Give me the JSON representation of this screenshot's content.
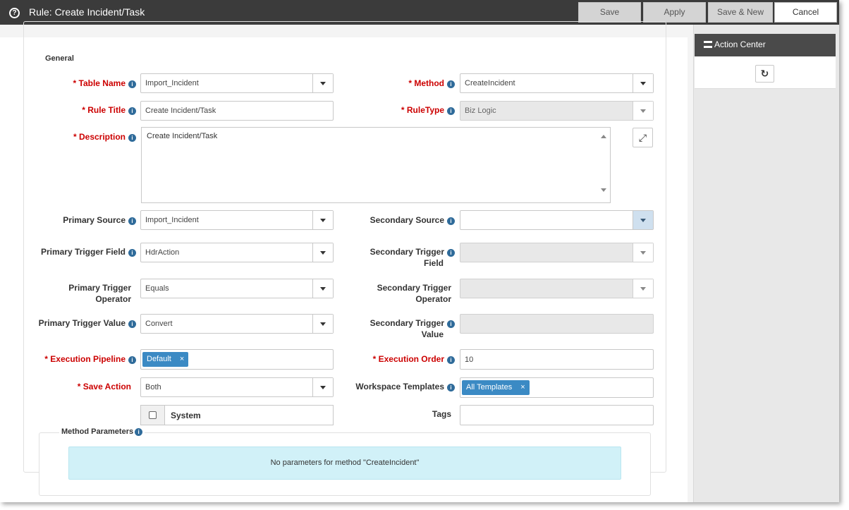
{
  "titlebar": {
    "title": "Rule: Create Incident/Task",
    "help_glyph": "?",
    "buttons": {
      "save": "Save",
      "apply": "Apply",
      "save_new": "Save & New",
      "cancel": "Cancel"
    }
  },
  "form": {
    "legend": "General",
    "table_name": {
      "label": "* Table Name",
      "value": "Import_Incident"
    },
    "method": {
      "label": "* Method",
      "value": "CreateIncident"
    },
    "rule_title": {
      "label": "* Rule Title",
      "value": "Create Incident/Task"
    },
    "rule_type": {
      "label": "* RuleType",
      "value": "Biz Logic"
    },
    "description": {
      "label": "* Description",
      "value": "Create Incident/Task"
    },
    "primary_source": {
      "label": "Primary Source",
      "value": "Import_Incident"
    },
    "secondary_source": {
      "label": "Secondary Source",
      "value": ""
    },
    "primary_trigger_field": {
      "label": "Primary Trigger Field",
      "value": "HdrAction"
    },
    "secondary_trigger_field": {
      "label_line1": "Secondary Trigger",
      "label_line2": "Field",
      "value": ""
    },
    "primary_trigger_operator": {
      "label_line1": "Primary Trigger",
      "label_line2": "Operator",
      "value": "Equals"
    },
    "secondary_trigger_operator": {
      "label_line1": "Secondary Trigger",
      "label_line2": "Operator",
      "value": ""
    },
    "primary_trigger_value": {
      "label": "Primary Trigger Value",
      "value": "Convert"
    },
    "secondary_trigger_value": {
      "label_line1": "Secondary Trigger",
      "label_line2": "Value",
      "value": ""
    },
    "execution_pipeline": {
      "label": "* Execution Pipeline",
      "tag": "Default"
    },
    "execution_order": {
      "label": "* Execution Order",
      "value": "10"
    },
    "save_action": {
      "label": "* Save Action",
      "value": "Both"
    },
    "workspace_templates": {
      "label": "Workspace Templates",
      "tag": "All Templates"
    },
    "system": {
      "label": "System",
      "checked": false
    },
    "tags": {
      "label": "Tags",
      "value": ""
    },
    "method_parameters": {
      "legend": "Method Parameters",
      "message": "No parameters for method \"CreateIncident\""
    }
  },
  "action_center": {
    "title": "Action Center",
    "icon": "menu-icon",
    "refresh_icon": "refresh-icon",
    "refresh_glyph": "↻"
  },
  "glyphs": {
    "info": "i",
    "remove": "×",
    "expand": "⤢"
  },
  "colors": {
    "title_bar": "#3b3b3b",
    "required_label": "#cc0000",
    "info_icon": "#2f6b9a",
    "tag_bg": "#3b8ac4",
    "alert_bg": "#d1f1f8",
    "action_center_header": "#4a4a4a"
  }
}
